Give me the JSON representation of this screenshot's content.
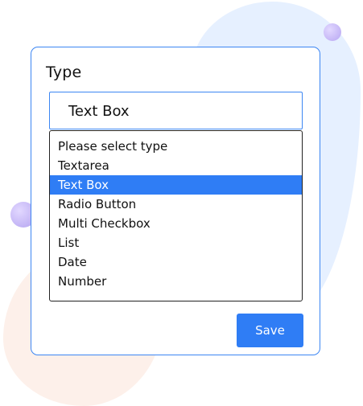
{
  "form": {
    "label": "Type",
    "selected_value": "Text Box",
    "options": [
      "Please select type",
      "Textarea",
      "Text Box",
      "Radio Button",
      "Multi Checkbox",
      "List",
      "Date",
      "Number"
    ],
    "highlighted_option": "Text Box",
    "save_label": "Save"
  },
  "colors": {
    "accent": "#2f7df5",
    "card_border": "#3c86f3",
    "highlight_text": "#ffffff",
    "background_blob_blue": "#e6f0ff",
    "background_blob_peach": "#fdf0ea",
    "background_dot": "#c4b5f6"
  }
}
